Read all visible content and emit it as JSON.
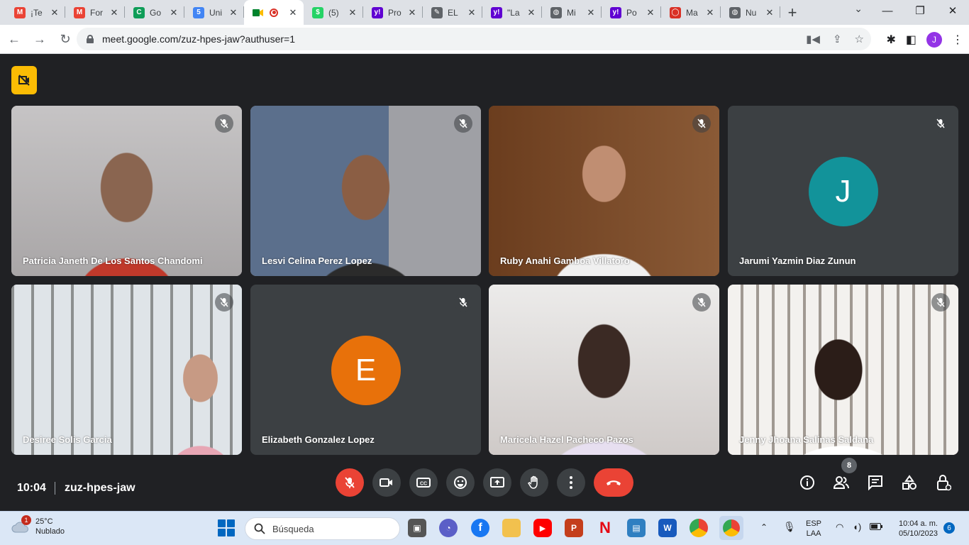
{
  "browser": {
    "tabs": [
      {
        "title": "¡Te",
        "icon": "gmail-icon",
        "color": "#ea4335",
        "glyph": "M"
      },
      {
        "title": "For",
        "icon": "gmail-icon",
        "color": "#ea4335",
        "glyph": "M"
      },
      {
        "title": "Go",
        "icon": "google-classroom-icon",
        "color": "#0f9d58",
        "glyph": "C"
      },
      {
        "title": "Uni",
        "icon": "calendar-icon",
        "color": "#4285f4",
        "glyph": "5"
      },
      {
        "title": "",
        "icon": "meet-recording-icon",
        "color": "#00832d",
        "glyph": "",
        "active": true
      },
      {
        "title": "(5)",
        "icon": "whatsapp-icon",
        "color": "#25d366",
        "glyph": "$"
      },
      {
        "title": "Pro",
        "icon": "yahoo-icon",
        "color": "#6001d2",
        "glyph": "y!"
      },
      {
        "title": "EL",
        "icon": "pen-icon",
        "color": "#5f6368",
        "glyph": "✎"
      },
      {
        "title": "\"La",
        "icon": "yahoo-icon",
        "color": "#6001d2",
        "glyph": "y!"
      },
      {
        "title": "Mi",
        "icon": "globe-icon",
        "color": "#5f6368",
        "glyph": "◍"
      },
      {
        "title": "Po",
        "icon": "yahoo-icon",
        "color": "#6001d2",
        "glyph": "y!"
      },
      {
        "title": "Ma",
        "icon": "chat-bubble-icon",
        "color": "#d93025",
        "glyph": "◯"
      },
      {
        "title": "Nu",
        "icon": "globe-icon",
        "color": "#5f6368",
        "glyph": "◍"
      }
    ],
    "url": "meet.google.com/zuz-hpes-jaw?authuser=1",
    "profile_initial": "J"
  },
  "meet": {
    "time": "10:04",
    "meeting_code": "zuz-hpes-jaw",
    "participants_count": "8",
    "participants": [
      {
        "name": "Patricia Janeth De Los Santos Chandomi",
        "type": "video",
        "bg": "#b6b3b4"
      },
      {
        "name": "Lesvi Celina Perez Lopez",
        "type": "video",
        "bg": "#8d8d92"
      },
      {
        "name": "Ruby Anahi Gamboa Villatoro",
        "type": "video",
        "bg": "#7a4a28"
      },
      {
        "name": "Jarumi Yazmin Diaz Zunun",
        "type": "avatar",
        "initial": "J",
        "avatar_color": "#12939a"
      },
      {
        "name": "Desiree Solis Garcia",
        "type": "video",
        "bg": "#9fa8b2"
      },
      {
        "name": "Elizabeth Gonzalez Lopez",
        "type": "avatar",
        "initial": "E",
        "avatar_color": "#e8710a"
      },
      {
        "name": "Maricela Hazel Pacheco Pazos",
        "type": "video",
        "bg": "#d7d3d2"
      },
      {
        "name": "Jenny Jhoana Salinas Saldana",
        "type": "video",
        "bg": "#bdb7b1"
      }
    ]
  },
  "taskbar": {
    "temperature": "25°C",
    "weather": "Nublado",
    "weather_badge": "1",
    "search_placeholder": "Búsqueda",
    "lang_top": "ESP",
    "lang_bottom": "LAA",
    "time": "10:04 a. m.",
    "date": "05/10/2023",
    "notifications": "6"
  }
}
